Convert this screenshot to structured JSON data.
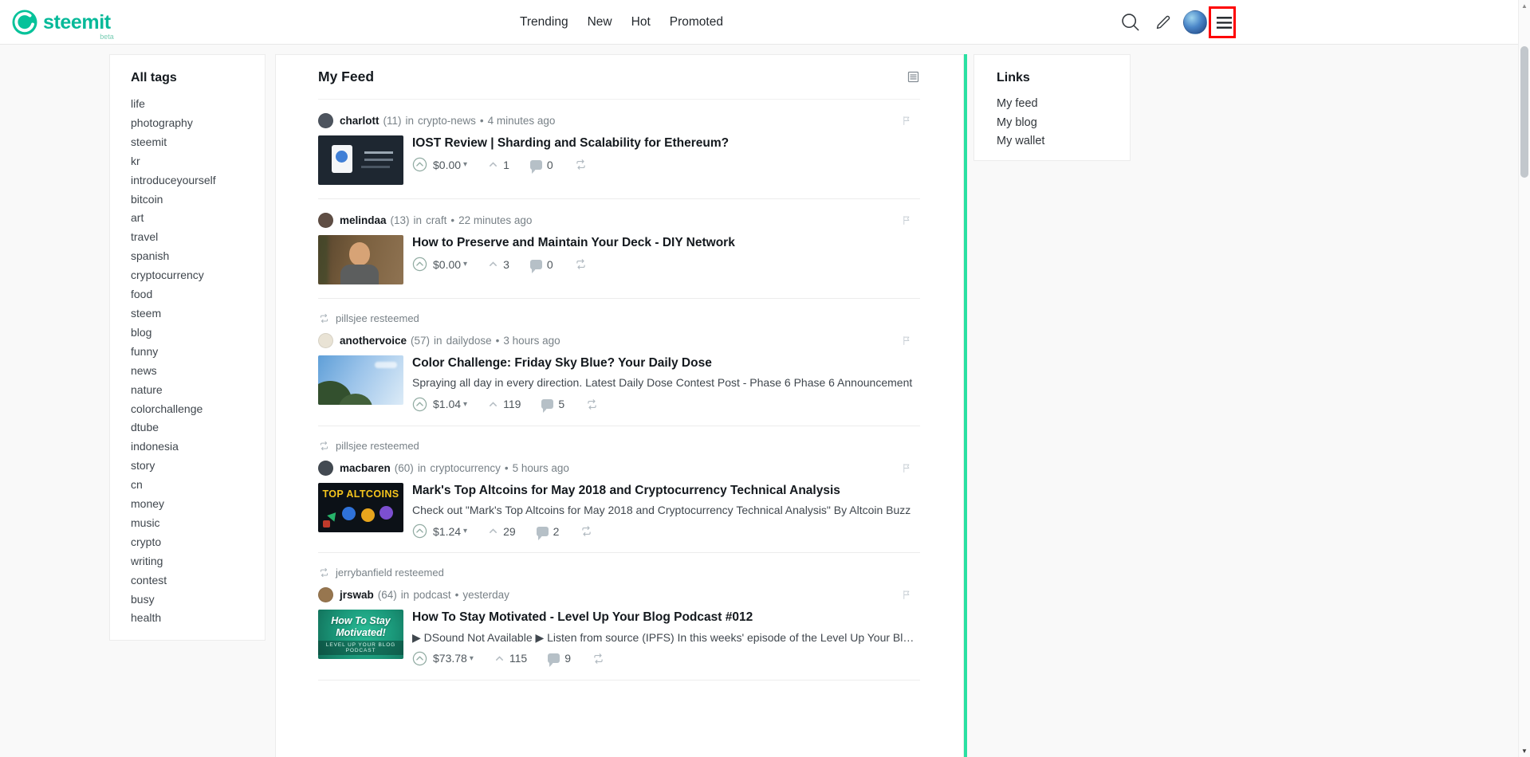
{
  "header": {
    "brand": "steemit",
    "beta": "beta",
    "nav": [
      "Trending",
      "New",
      "Hot",
      "Promoted"
    ]
  },
  "sidebar": {
    "title": "All tags",
    "tags": [
      "life",
      "photography",
      "steemit",
      "kr",
      "introduceyourself",
      "bitcoin",
      "art",
      "travel",
      "spanish",
      "cryptocurrency",
      "food",
      "steem",
      "blog",
      "funny",
      "news",
      "nature",
      "colorchallenge",
      "dtube",
      "indonesia",
      "story",
      "cn",
      "money",
      "music",
      "crypto",
      "writing",
      "contest",
      "busy",
      "health"
    ]
  },
  "feed": {
    "title": "My Feed",
    "posts": [
      {
        "author": "charlott",
        "rep": "(11)",
        "in_word": "in",
        "category": "crypto-news",
        "bullet": "•",
        "time": "4 minutes ago",
        "title": "IOST Review | Sharding and Scalability for Ethereum?",
        "payout": "$0.00",
        "votes": "1",
        "comments": "0",
        "avatar_color": "#4d545e"
      },
      {
        "author": "melindaa",
        "rep": "(13)",
        "in_word": "in",
        "category": "craft",
        "bullet": "•",
        "time": "22 minutes ago",
        "title": "How to Preserve and Maintain Your Deck - DIY Network",
        "payout": "$0.00",
        "votes": "3",
        "comments": "0",
        "avatar_color": "#5f4e44"
      },
      {
        "resteemed_by": "pillsjee resteemed",
        "author": "anothervoice",
        "rep": "(57)",
        "in_word": "in",
        "category": "dailydose",
        "bullet": "•",
        "time": "3 hours ago",
        "title": "Color Challenge: Friday Sky Blue? Your Daily Dose",
        "summary": "Spraying all day in every direction. Latest Daily Dose Contest Post - Phase 6 Phase 6 Announcement",
        "payout": "$1.04",
        "votes": "119",
        "comments": "5",
        "avatar_color": "#e9e3d5"
      },
      {
        "resteemed_by": "pillsjee resteemed",
        "author": "macbaren",
        "rep": "(60)",
        "in_word": "in",
        "category": "cryptocurrency",
        "bullet": "•",
        "time": "5 hours ago",
        "title": "Mark's Top Altcoins for May 2018 and Cryptocurrency Technical Analysis",
        "summary": "Check out \"Mark's Top Altcoins for May 2018 and Cryptocurrency Technical Analysis\" By Altcoin Buzz",
        "payout": "$1.24",
        "votes": "29",
        "comments": "2",
        "avatar_color": "#434a52",
        "thumb_text": "TOP ALTCOINS"
      },
      {
        "resteemed_by": "jerrybanfield resteemed",
        "author": "jrswab",
        "rep": "(64)",
        "in_word": "in",
        "category": "podcast",
        "bullet": "•",
        "time": "yesterday",
        "title": "How To Stay Motivated - Level Up Your Blog Podcast #012",
        "summary": "▶ DSound Not Available ▶ Listen from source (IPFS) In this weeks' episode of the Level Up Your Blog pod…",
        "payout": "$73.78",
        "votes": "115",
        "comments": "9",
        "avatar_color": "#97764f",
        "thumb_text": "How To Stay Motivated!",
        "thumb_sub": "LEVEL UP YOUR BLOG PODCAST"
      }
    ]
  },
  "links_panel": {
    "title": "Links",
    "items": [
      "My feed",
      "My blog",
      "My wallet"
    ]
  },
  "colors": {
    "brand_teal": "#06b999",
    "divider_green": "#2ae0a2",
    "annotation_red": "#fe0000"
  }
}
